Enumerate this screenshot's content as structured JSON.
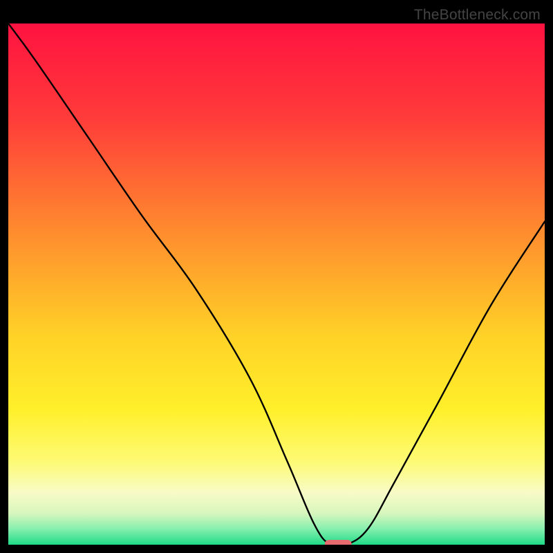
{
  "watermark": "TheBottleneck.com",
  "chart_data": {
    "type": "line",
    "title": "",
    "xlabel": "",
    "ylabel": "",
    "xlim": [
      0,
      100
    ],
    "ylim": [
      0,
      100
    ],
    "grid": false,
    "legend": false,
    "series": [
      {
        "name": "bottleneck-curve",
        "x": [
          0,
          5,
          15,
          25,
          35,
          45,
          52,
          57,
          60,
          63,
          67,
          72,
          80,
          90,
          100
        ],
        "values": [
          100,
          93,
          78,
          63,
          49,
          32,
          16,
          4,
          0,
          0,
          3,
          12,
          27,
          46,
          62
        ]
      }
    ],
    "marker": {
      "name": "sweet-spot",
      "x_start": 59,
      "x_end": 64,
      "y": 0,
      "color": "#e76b6e"
    },
    "background_gradient": {
      "stops": [
        {
          "offset": 0.0,
          "color": "#ff1240"
        },
        {
          "offset": 0.18,
          "color": "#ff3b3a"
        },
        {
          "offset": 0.4,
          "color": "#ff8c2e"
        },
        {
          "offset": 0.6,
          "color": "#ffd227"
        },
        {
          "offset": 0.74,
          "color": "#ffef2a"
        },
        {
          "offset": 0.84,
          "color": "#fdfb74"
        },
        {
          "offset": 0.9,
          "color": "#f8fbc6"
        },
        {
          "offset": 0.94,
          "color": "#d7f6bd"
        },
        {
          "offset": 0.97,
          "color": "#85efae"
        },
        {
          "offset": 1.0,
          "color": "#1fdb87"
        }
      ]
    }
  }
}
